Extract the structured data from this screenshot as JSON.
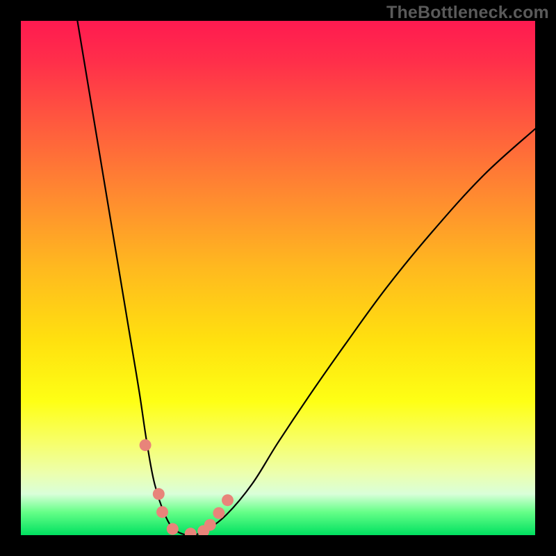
{
  "watermark": "TheBottleneck.com",
  "chart_data": {
    "type": "line",
    "title": "",
    "xlabel": "",
    "ylabel": "",
    "xlim": [
      0,
      100
    ],
    "ylim": [
      0,
      100
    ],
    "series": [
      {
        "name": "bottleneck-curve",
        "x": [
          11,
          13,
          15,
          17,
          19,
          21,
          23,
          24.5,
          26,
          28,
          30,
          33,
          36,
          40,
          45,
          50,
          56,
          63,
          71,
          80,
          90,
          100
        ],
        "values": [
          100,
          88,
          76,
          64,
          52,
          40,
          28,
          18,
          10,
          4,
          1,
          0,
          1,
          4,
          10,
          18,
          27,
          37,
          48,
          59,
          70,
          79
        ]
      }
    ],
    "markers": [
      {
        "name": "p1",
        "x": 24.2,
        "y": 17.5
      },
      {
        "name": "p2",
        "x": 26.8,
        "y": 8.0
      },
      {
        "name": "p3",
        "x": 27.5,
        "y": 4.5
      },
      {
        "name": "p4",
        "x": 29.5,
        "y": 1.2
      },
      {
        "name": "p5",
        "x": 33.0,
        "y": 0.3
      },
      {
        "name": "p6",
        "x": 35.5,
        "y": 0.8
      },
      {
        "name": "p7",
        "x": 36.8,
        "y": 2.0
      },
      {
        "name": "p8",
        "x": 38.5,
        "y": 4.3
      },
      {
        "name": "p9",
        "x": 40.2,
        "y": 6.8
      }
    ],
    "marker_color": "#e8847a",
    "curve_color": "#000000"
  }
}
